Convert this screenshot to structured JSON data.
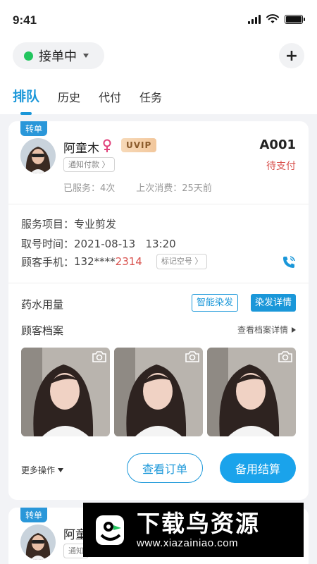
{
  "status_bar": {
    "time": "9:41"
  },
  "header": {
    "status_label": "接单中",
    "add_label": "+",
    "status_color": "#22c55e"
  },
  "tabs": [
    {
      "label": "排队",
      "active": true
    },
    {
      "label": "历史",
      "active": false
    },
    {
      "label": "代付",
      "active": false
    },
    {
      "label": "任务",
      "active": false
    }
  ],
  "card": {
    "tag": "转单",
    "customer_name": "阿童木",
    "vip": "UVIP",
    "notify_btn": "通知付款 〉",
    "queue_no": "A001",
    "order_status": "待支付",
    "served": "已服务：4次",
    "last_spend": "上次消费：25天前",
    "service_label": "服务项目：",
    "service_value": "专业剪发",
    "time_label": "取号时间：",
    "time_value": "2021-08-13   13:20",
    "phone_label": "顾客手机：",
    "phone_masked": "132****",
    "phone_tail": "2314",
    "mark_btn": "标记空号 〉",
    "dye_title": "药水用量",
    "smart_dye": "智能染发",
    "dye_detail": "染发详情",
    "archive_title": "顾客档案",
    "archive_link": "查看档案详情",
    "more_ops": "更多操作",
    "view_order": "查看订单",
    "settle": "备用结算"
  },
  "card2": {
    "tag": "转单",
    "customer_name": "阿童",
    "notify_btn": "通知"
  },
  "watermark": {
    "title": "下载鸟资源",
    "url": "www.xiazainiao.com"
  },
  "colors": {
    "accent": "#1a97d9",
    "danger": "#d9534f",
    "primary_button": "#1aa3eb"
  }
}
